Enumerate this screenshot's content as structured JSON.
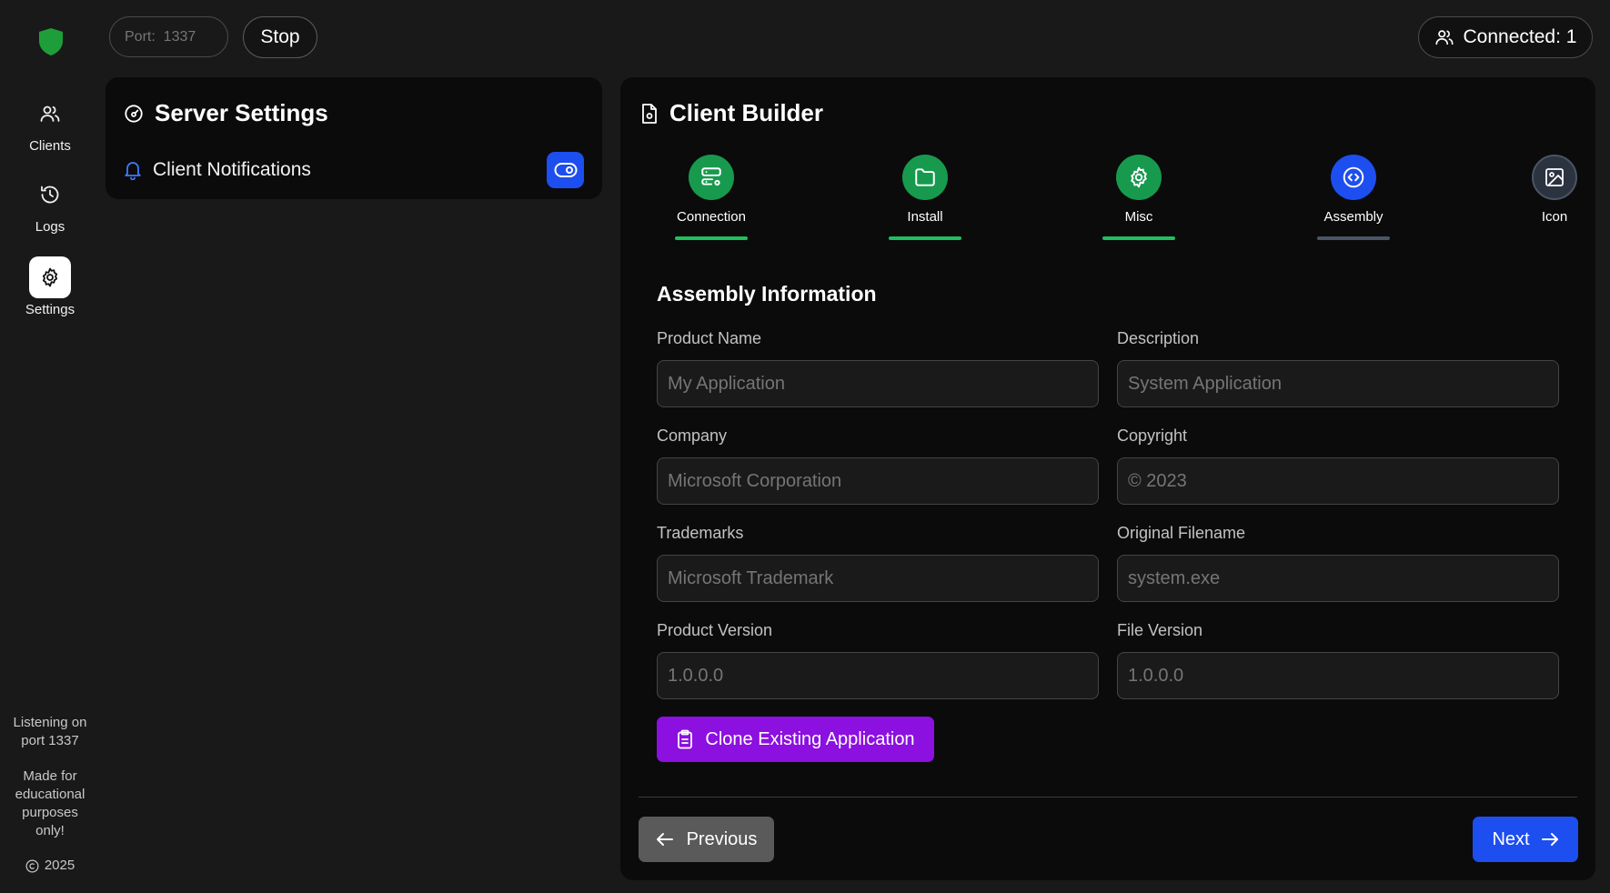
{
  "sidebar": {
    "logo_icon": "shield-icon",
    "items": [
      {
        "label": "Clients",
        "icon": "users-icon"
      },
      {
        "label": "Logs",
        "icon": "history-icon"
      },
      {
        "label": "Settings",
        "icon": "gear-icon",
        "active": true
      }
    ],
    "footer": {
      "listening_line1": "Listening on",
      "listening_line2": "port 1337",
      "note_line1": "Made for",
      "note_line2": "educational",
      "note_line3": "purposes",
      "note_line4": "only!",
      "copyright_year": "2025"
    }
  },
  "topbar": {
    "port_placeholder": "Port:  1337",
    "stop_label": "Stop",
    "connected_label": "Connected:",
    "connected_count": "1"
  },
  "server_settings": {
    "title": "Server Settings",
    "notifications_label": "Client Notifications",
    "notifications_enabled": true
  },
  "client_builder": {
    "title": "Client Builder",
    "steps": [
      {
        "label": "Connection",
        "icon": "server-cog-icon",
        "state": "done"
      },
      {
        "label": "Install",
        "icon": "folder-icon",
        "state": "done"
      },
      {
        "label": "Misc",
        "icon": "gear-icon",
        "state": "done"
      },
      {
        "label": "Assembly",
        "icon": "code-circle-icon",
        "state": "current"
      },
      {
        "label": "Icon",
        "icon": "image-icon",
        "state": "pending"
      }
    ],
    "section_title": "Assembly Information",
    "fields": {
      "product_name": {
        "label": "Product Name",
        "placeholder": "My Application"
      },
      "description": {
        "label": "Description",
        "placeholder": "System Application"
      },
      "company": {
        "label": "Company",
        "placeholder": "Microsoft Corporation"
      },
      "copyright": {
        "label": "Copyright",
        "placeholder": "© 2023"
      },
      "trademarks": {
        "label": "Trademarks",
        "placeholder": "Microsoft Trademark"
      },
      "original_filename": {
        "label": "Original Filename",
        "placeholder": "system.exe"
      },
      "product_version": {
        "label": "Product Version",
        "placeholder": "1.0.0.0"
      },
      "file_version": {
        "label": "File Version",
        "placeholder": "1.0.0.0"
      }
    },
    "clone_label": "Clone Existing Application",
    "previous_label": "Previous",
    "next_label": "Next"
  },
  "colors": {
    "background": "#191919",
    "card": "#0b0b0b",
    "accent_blue": "#1d4ef0",
    "step_done_green": "#179a4e",
    "clone_purple": "#8c10e0",
    "logo_green": "#1e9e3a"
  }
}
